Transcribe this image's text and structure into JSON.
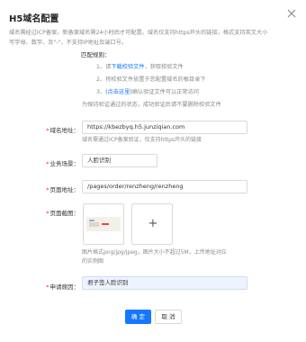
{
  "dialog": {
    "title": "H5域名配置",
    "description_line1": "域名需经过ICP备案，新备案域名需24小时后才可配置。域名仅支持https开头的链接，格式支持英文大小",
    "description_line2": "写字母、数字、及\"-\"，不支持IP地址及端口号。"
  },
  "match_rules": {
    "title": "匹配规则：",
    "rule1_prefix": "1、请",
    "rule1_link": "下载校验文件",
    "rule1_suffix": "，获取校验文件",
    "rule2": "2、将校验文件放置于您配置域名的根目录下",
    "rule3_prefix": "3、",
    "rule3_link": "(点击这里)",
    "rule3_suffix": "确认验证文件可以正常访问",
    "rule4": "为保持验证通过的状态，成功验证后请不要删除校验文件"
  },
  "form": {
    "domain": {
      "label": "域名地址：",
      "value": "https://kbezbyq.h5.junziqian.com",
      "help": "域名需通过ICP备案验证，仅支持https开头的链接"
    },
    "scene": {
      "label": "业务场景：",
      "value": "人脸识别"
    },
    "page_url": {
      "label": "页面地址：",
      "value": "/pages/order/renzheng/renzheng"
    },
    "screenshot": {
      "label": "页面截图：",
      "add_icon": "+",
      "help_line1": "图片格式png/jpg/jpeg，图片大小不超过5M，上传地址对应",
      "help_line2": "的实例图"
    },
    "reason": {
      "label": "申请原因：",
      "value": "君子签人脸识别"
    }
  },
  "actions": {
    "confirm": "确 定",
    "cancel": "取 消"
  }
}
